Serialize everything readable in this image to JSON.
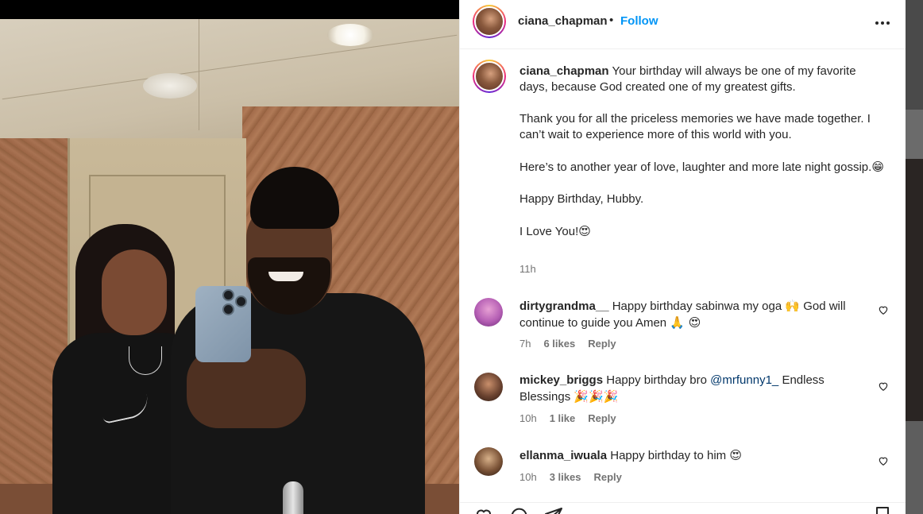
{
  "post": {
    "username": "ciana_chapman",
    "separator": "•",
    "follow_label": "Follow",
    "more_label": "•••"
  },
  "caption": {
    "username": "ciana_chapman",
    "paragraphs": [
      "Your birthday will always be one of my favorite days, because God created one of my greatest gifts.",
      "Thank you for all the priceless memories we have made together. I can’t wait to experience more of this world with you.",
      "Here’s to another year of love, laughter and more late night gossip.",
      "Happy Birthday, Hubby.",
      "I Love You!"
    ],
    "emoji_gossip": "😁",
    "emoji_love": "😍",
    "time": "11h"
  },
  "comments": [
    {
      "username": "dirtygrandma__",
      "text_1": "Happy birthday sabinwa my oga",
      "emoji_1": "🙌",
      "text_2": "God will continue to guide you Amen",
      "emoji_2": "🙏 😍",
      "time": "7h",
      "likes": "6 likes",
      "reply": "Reply"
    },
    {
      "username": "mickey_briggs",
      "text_1": "Happy birthday bro",
      "mention": "@mrfunny1_",
      "text_2": "Endless Blessings",
      "emoji_1": "🎉🎉🎉",
      "time": "10h",
      "likes": "1 like",
      "reply": "Reply"
    },
    {
      "username": "ellanma_iwuala",
      "text_1": "Happy birthday to him",
      "emoji_1": "😍",
      "time": "10h",
      "likes": "3 likes",
      "reply": "Reply"
    }
  ],
  "icons": [
    "more-options-icon",
    "heart-icon",
    "comment-icon",
    "share-icon",
    "bookmark-icon"
  ],
  "colors": {
    "follow": "#0095f6",
    "mention": "#00376b",
    "meta": "#737373",
    "text": "#262626"
  }
}
